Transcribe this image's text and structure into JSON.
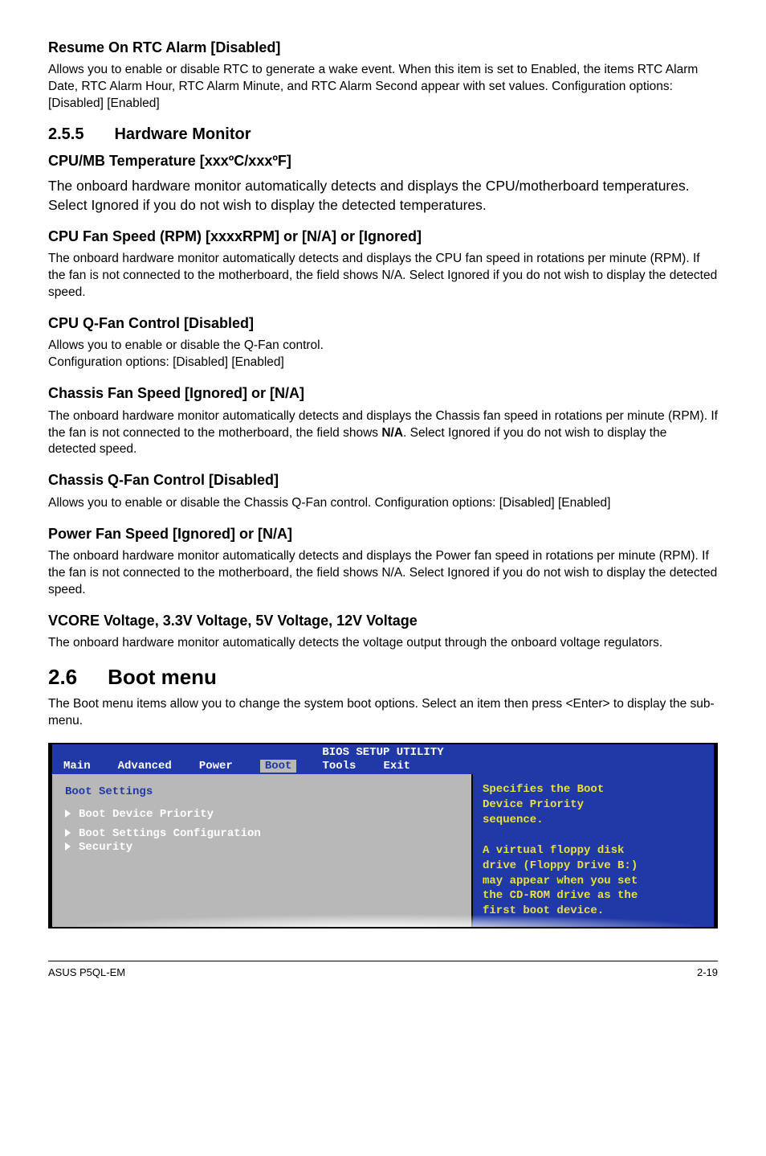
{
  "sections": {
    "s1": {
      "title": "Resume On RTC Alarm [Disabled]",
      "body": "Allows you to enable or disable RTC to generate a wake event. When this item is set to Enabled, the items RTC Alarm Date, RTC Alarm Hour, RTC Alarm Minute, and RTC Alarm Second appear with set values. Configuration options: [Disabled] [Enabled]"
    },
    "h2": {
      "num": "2.5.5",
      "title": "Hardware Monitor"
    },
    "s2": {
      "title": "CPU/MB Temperature [xxxºC/xxxºF]",
      "body": "The onboard hardware monitor automatically detects and displays the CPU/motherboard temperatures. Select Ignored if you do not wish to display the detected temperatures."
    },
    "s3": {
      "title": "CPU Fan Speed (RPM) [xxxxRPM] or [N/A] or [Ignored]",
      "body": "The onboard hardware monitor automatically detects and displays the CPU fan speed in rotations per minute (RPM). If the fan is not connected to the motherboard, the field shows N/A. Select Ignored if you do not wish to display the detected speed."
    },
    "s4": {
      "title": "CPU Q-Fan Control [Disabled]",
      "body": "Allows you to enable or disable the Q-Fan control.\nConfiguration options: [Disabled] [Enabled]"
    },
    "s5": {
      "title": "Chassis Fan Speed [Ignored] or [N/A]",
      "body_pre": "The onboard hardware monitor automatically detects and displays the Chassis fan speed in rotations per minute (RPM). If the fan is not connected to the motherboard, the field shows ",
      "body_bold": "N/A",
      "body_post": ". Select Ignored if you do not wish to display the detected speed."
    },
    "s6": {
      "title": "Chassis Q-Fan Control [Disabled]",
      "body": "Allows you to enable or disable the Chassis Q-Fan control. Configuration options: [Disabled] [Enabled]"
    },
    "s7": {
      "title": "Power Fan Speed [Ignored] or [N/A]",
      "body": "The onboard hardware monitor automatically detects and displays the Power fan speed in rotations per minute (RPM). If the fan is not connected to the motherboard, the field shows N/A. Select Ignored if you do not wish to display the detected speed."
    },
    "s8": {
      "title": "VCORE Voltage, 3.3V Voltage, 5V Voltage, 12V Voltage",
      "body": "The onboard hardware monitor automatically detects the voltage output through the onboard voltage regulators."
    },
    "h1": {
      "num": "2.6",
      "title": "Boot menu"
    },
    "boot_intro": "The Boot menu items allow you to change the system boot options. Select an item then press <Enter> to display the sub-menu."
  },
  "bios": {
    "title": "BIOS SETUP UTILITY",
    "tabs": [
      "Main",
      "Advanced",
      "Power",
      "Boot",
      "Tools",
      "Exit"
    ],
    "active_tab": "Boot",
    "left_header": "Boot Settings",
    "items": [
      "Boot Device Priority",
      "Boot Settings Configuration",
      "Security"
    ],
    "help_lines": [
      "Specifies the Boot",
      "Device Priority",
      "sequence.",
      "",
      "A virtual floppy disk",
      "drive (Floppy Drive B:)",
      "may appear when you set",
      "the CD-ROM drive as the",
      "first boot device."
    ]
  },
  "footer": {
    "left": "ASUS P5QL-EM",
    "right": "2-19"
  }
}
